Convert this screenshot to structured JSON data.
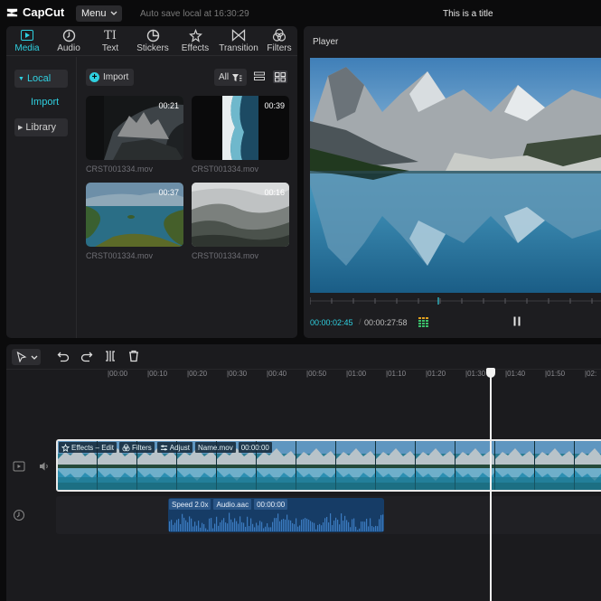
{
  "app": {
    "name": "CapCut",
    "menu_label": "Menu",
    "autosave": "Auto save local at 16:30:29",
    "title": "This is a title"
  },
  "tabs": [
    {
      "label": "Media",
      "icon": "media-icon",
      "active": true
    },
    {
      "label": "Audio",
      "icon": "audio-icon"
    },
    {
      "label": "Text",
      "icon": "text-icon"
    },
    {
      "label": "Stickers",
      "icon": "stickers-icon"
    },
    {
      "label": "Effects",
      "icon": "effects-icon"
    },
    {
      "label": "Transition",
      "icon": "transition-icon"
    },
    {
      "label": "Filters",
      "icon": "filters-icon"
    }
  ],
  "sidebar": {
    "local": "Local",
    "import": "Import",
    "library": "Library"
  },
  "media": {
    "import_label": "Import",
    "filter_label": "All",
    "items": [
      {
        "name": "CRST001334.mov",
        "duration": "00:21"
      },
      {
        "name": "CRST001334.mov",
        "duration": "00:39"
      },
      {
        "name": "CRST001334.mov",
        "duration": "00:37"
      },
      {
        "name": "CRST001334.mov",
        "duration": "00:16"
      }
    ]
  },
  "player": {
    "label": "Player",
    "current_time": "00:00:02:45",
    "total_time": "00:00:27:58"
  },
  "timeline": {
    "ruler": [
      "|00:00",
      "|00:10",
      "|00:20",
      "|00:30",
      "|00:40",
      "|00:50",
      "|01:00",
      "|01:10",
      "|01:20",
      "|01:30",
      "|01:40",
      "|01:50",
      "|02:"
    ],
    "video_tags": {
      "effects": "Effects – Edit",
      "filters": "Filters",
      "adjust": "Adjust",
      "name": "Name.mov",
      "time": "00:00:00"
    },
    "audio_tags": {
      "speed": "Speed 2.0x",
      "name": "Audio.aac",
      "time": "00:00:00"
    }
  },
  "colors": {
    "accent": "#2fd0e0",
    "panel": "#1d1d20",
    "background": "#0b0b0c",
    "audio_clip": "#163c66",
    "video_clip": "#1b6a7a"
  }
}
